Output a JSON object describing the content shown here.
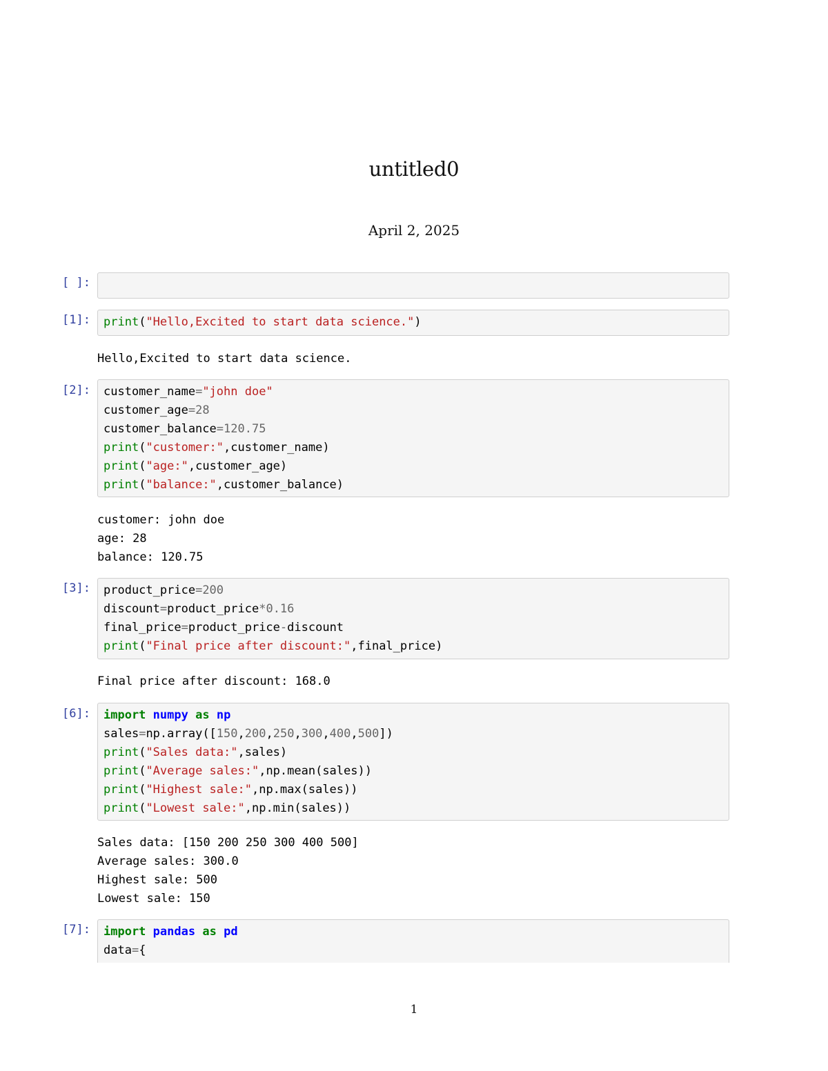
{
  "document": {
    "title": "untitled0",
    "date": "April 2, 2025",
    "page_number": "1"
  },
  "cells": [
    {
      "prompt": "[ ]:",
      "lines": [],
      "output": []
    },
    {
      "prompt": "[1]:",
      "lines": [
        [
          [
            "fn",
            "print"
          ],
          [
            "id",
            "("
          ],
          [
            "str",
            "\"Hello,Excited to start data science.\""
          ],
          [
            "id",
            ")"
          ]
        ]
      ],
      "output": [
        "Hello,Excited to start data science."
      ]
    },
    {
      "prompt": "[2]:",
      "lines": [
        [
          [
            "id",
            "customer_name"
          ],
          [
            "op",
            "="
          ],
          [
            "str",
            "\"john doe\""
          ]
        ],
        [
          [
            "id",
            "customer_age"
          ],
          [
            "op",
            "="
          ],
          [
            "num",
            "28"
          ]
        ],
        [
          [
            "id",
            "customer_balance"
          ],
          [
            "op",
            "="
          ],
          [
            "num",
            "120.75"
          ]
        ],
        [
          [
            "fn",
            "print"
          ],
          [
            "id",
            "("
          ],
          [
            "str",
            "\"customer:\""
          ],
          [
            "id",
            ",customer_name)"
          ]
        ],
        [
          [
            "fn",
            "print"
          ],
          [
            "id",
            "("
          ],
          [
            "str",
            "\"age:\""
          ],
          [
            "id",
            ",customer_age)"
          ]
        ],
        [
          [
            "fn",
            "print"
          ],
          [
            "id",
            "("
          ],
          [
            "str",
            "\"balance:\""
          ],
          [
            "id",
            ",customer_balance)"
          ]
        ]
      ],
      "output": [
        "customer: john doe",
        "age: 28",
        "balance: 120.75"
      ]
    },
    {
      "prompt": "[3]:",
      "lines": [
        [
          [
            "id",
            "product_price"
          ],
          [
            "op",
            "="
          ],
          [
            "num",
            "200"
          ]
        ],
        [
          [
            "id",
            "discount"
          ],
          [
            "op",
            "="
          ],
          [
            "id",
            "product_price"
          ],
          [
            "op",
            "*"
          ],
          [
            "num",
            "0.16"
          ]
        ],
        [
          [
            "id",
            "final_price"
          ],
          [
            "op",
            "="
          ],
          [
            "id",
            "product_price"
          ],
          [
            "op",
            "-"
          ],
          [
            "id",
            "discount"
          ]
        ],
        [
          [
            "fn",
            "print"
          ],
          [
            "id",
            "("
          ],
          [
            "str",
            "\"Final price after discount:\""
          ],
          [
            "id",
            ",final_price)"
          ]
        ]
      ],
      "output": [
        "Final price after discount: 168.0"
      ]
    },
    {
      "prompt": "[6]:",
      "lines": [
        [
          [
            "kw",
            "import"
          ],
          [
            "id",
            " "
          ],
          [
            "mod",
            "numpy"
          ],
          [
            "id",
            " "
          ],
          [
            "kw",
            "as"
          ],
          [
            "id",
            " "
          ],
          [
            "mod",
            "np"
          ]
        ],
        [
          [
            "id",
            "sales"
          ],
          [
            "op",
            "="
          ],
          [
            "id",
            "np.array(["
          ],
          [
            "num",
            "150"
          ],
          [
            "id",
            ","
          ],
          [
            "num",
            "200"
          ],
          [
            "id",
            ","
          ],
          [
            "num",
            "250"
          ],
          [
            "id",
            ","
          ],
          [
            "num",
            "300"
          ],
          [
            "id",
            ","
          ],
          [
            "num",
            "400"
          ],
          [
            "id",
            ","
          ],
          [
            "num",
            "500"
          ],
          [
            "id",
            "])"
          ]
        ],
        [
          [
            "fn",
            "print"
          ],
          [
            "id",
            "("
          ],
          [
            "str",
            "\"Sales data:\""
          ],
          [
            "id",
            ",sales)"
          ]
        ],
        [
          [
            "fn",
            "print"
          ],
          [
            "id",
            "("
          ],
          [
            "str",
            "\"Average sales:\""
          ],
          [
            "id",
            ",np.mean(sales))"
          ]
        ],
        [
          [
            "fn",
            "print"
          ],
          [
            "id",
            "("
          ],
          [
            "str",
            "\"Highest sale:\""
          ],
          [
            "id",
            ",np.max(sales))"
          ]
        ],
        [
          [
            "fn",
            "print"
          ],
          [
            "id",
            "("
          ],
          [
            "str",
            "\"Lowest sale:\""
          ],
          [
            "id",
            ",np.min(sales))"
          ]
        ]
      ],
      "output": [
        "Sales data: [150 200 250 300 400 500]",
        "Average sales: 300.0",
        "Highest sale: 500",
        "Lowest sale: 150"
      ]
    },
    {
      "prompt": "[7]:",
      "lines": [
        [
          [
            "kw",
            "import"
          ],
          [
            "id",
            " "
          ],
          [
            "mod",
            "pandas"
          ],
          [
            "id",
            " "
          ],
          [
            "kw",
            "as"
          ],
          [
            "id",
            " "
          ],
          [
            "mod",
            "pd"
          ]
        ],
        [
          [
            "id",
            "data"
          ],
          [
            "op",
            "="
          ],
          [
            "id",
            "{"
          ]
        ]
      ],
      "output": []
    }
  ],
  "colors": {
    "prompt": "#303f9f",
    "keyword": "#008000",
    "string": "#ba2121",
    "number": "#666666",
    "module": "#0000ff",
    "cell_background": "#f5f5f5",
    "cell_border": "#cfcfcf"
  }
}
